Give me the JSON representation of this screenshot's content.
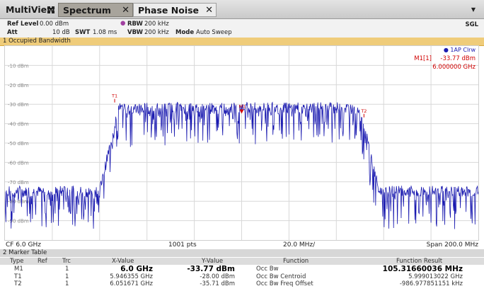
{
  "tabs": {
    "multiview": "MultiView",
    "spectrum": "Spectrum",
    "phase_noise": "Phase Noise",
    "close": "✕"
  },
  "info": {
    "ref_level_label": "Ref Level",
    "ref_level": "0.00 dBm",
    "att_label": "Att",
    "att": "10 dB",
    "swt_label": "SWT",
    "swt": "1.08 ms",
    "rbw_label": "RBW",
    "rbw": "200 kHz",
    "vbw_label": "VBW",
    "vbw": "200 kHz",
    "mode_label": "Mode",
    "mode": "Auto Sweep",
    "sgl": "SGL"
  },
  "window": {
    "title": "1 Occupied Bandwidth",
    "trace_label": "1AP Clrw",
    "marker_readout_name": "M1[1]",
    "marker_readout_level": "-33.77 dBm",
    "marker_readout_freq": "6.000000 GHz"
  },
  "axis": {
    "center": "CF 6.0 GHz",
    "points": "1001 pts",
    "div": "20.0 MHz/",
    "span": "Span 200.0 MHz"
  },
  "chart_data": {
    "type": "line",
    "y_labels": [
      "-10 dBm",
      "-20 dBm",
      "-30 dBm",
      "-40 dBm",
      "-50 dBm",
      "-60 dBm",
      "-70 dBm",
      "-80 dBm",
      "-90 dBm"
    ],
    "yrange_dbm": [
      -100,
      0
    ],
    "x_range_ghz": [
      5.9,
      6.1
    ],
    "grid": true,
    "trace_color": "#1a1ab0",
    "marker_color": "#d00000",
    "spectrum_profile": {
      "noise_floor_dbm": -75,
      "plateau_dbm": -32,
      "plateau_from_ghz": 5.948,
      "plateau_to_ghz": 6.05
    },
    "markers": [
      {
        "name": "T1",
        "x_ghz": 5.946355,
        "y_dbm": -28.0
      },
      {
        "name": "M1",
        "x_ghz": 6.0,
        "y_dbm": -33.77
      },
      {
        "name": "T2",
        "x_ghz": 6.051671,
        "y_dbm": -35.71
      }
    ]
  },
  "marker_table": {
    "title": "2 Marker Table",
    "headers": [
      "Type",
      "Ref",
      "Trc",
      "X-Value",
      "Y-Value",
      "Function",
      "Function Result"
    ],
    "rows": [
      {
        "type": "M1",
        "ref": "",
        "trc": "1",
        "x": "6.0 GHz",
        "y": "-33.77 dBm",
        "function": "Occ Bw",
        "result": "105.31660036 MHz"
      },
      {
        "type": "T1",
        "ref": "",
        "trc": "1",
        "x": "5.946355 GHz",
        "y": "-28.00 dBm",
        "function": "Occ Bw Centroid",
        "result": "5.999013022 GHz"
      },
      {
        "type": "T2",
        "ref": "",
        "trc": "1",
        "x": "6.051671 GHz",
        "y": "-35.71 dBm",
        "function": "Occ Bw Freq Offset",
        "result": "-986.977851151 kHz"
      }
    ]
  }
}
